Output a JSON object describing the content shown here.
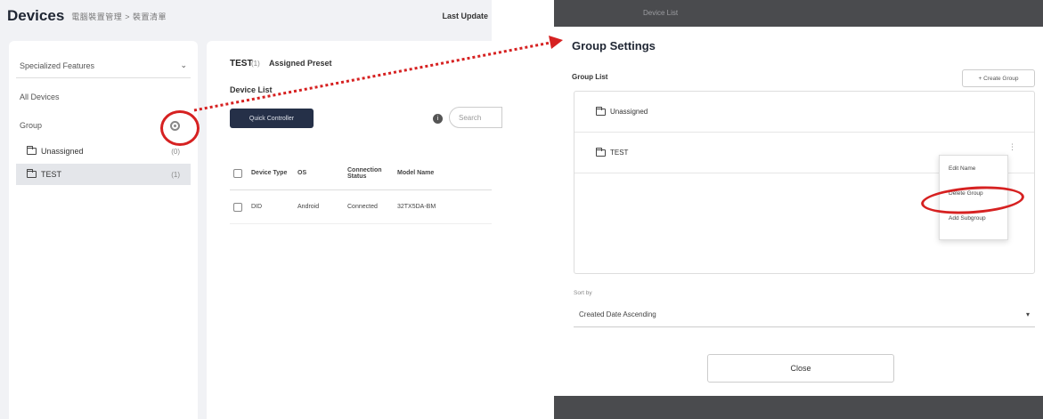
{
  "left": {
    "page_title": "Devices",
    "breadcrumb": "電腦裝置管理 > 裝置清單",
    "last_update": "Last Update",
    "sidebar": {
      "feature_select": "Specialized Features",
      "all_devices": "All Devices",
      "group_label": "Group",
      "folders": [
        {
          "label": "Unassigned",
          "count": "(0)"
        },
        {
          "label": "TEST",
          "count": "(1)"
        }
      ]
    },
    "main": {
      "group_name": "TEST",
      "group_count": "(1)",
      "preset": "Assigned Preset",
      "device_list_label": "Device List",
      "quick_button": "Quick Controller",
      "search_placeholder": "Search",
      "table": {
        "headers": [
          "Device Type",
          "OS",
          "Connection Status",
          "Model Name"
        ],
        "rows": [
          [
            "DID",
            "Android",
            "Connected",
            "32TX5DA-BM"
          ]
        ]
      }
    }
  },
  "right": {
    "header_label": "Device List",
    "modal_title": "Group Settings",
    "group_list_label": "Group List",
    "create_button": "+ Create Group",
    "groups": [
      "Unassigned",
      "TEST"
    ],
    "context_menu": [
      "Edit Name",
      "Delete Group",
      "Add Subgroup"
    ],
    "sort_label": "Sort by",
    "sort_value": "Created Date Ascending",
    "close_button": "Close"
  },
  "colors": {
    "annotation_red": "#d62121",
    "dark_button": "#253048"
  }
}
